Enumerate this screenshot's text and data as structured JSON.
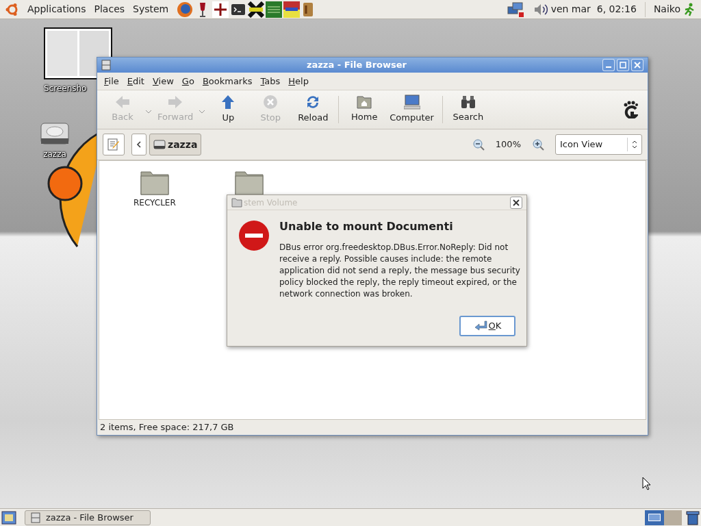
{
  "top_panel": {
    "menus": [
      "Applications",
      "Places",
      "System"
    ],
    "clock": "ven mar  6, 02:16",
    "user": "Naiko"
  },
  "desktop_icons": [
    {
      "label": "Screensho",
      "kind": "thumbnail"
    },
    {
      "label": "zazza",
      "kind": "drive"
    }
  ],
  "window": {
    "title": "zazza - File Browser",
    "menu": [
      "File",
      "Edit",
      "View",
      "Go",
      "Bookmarks",
      "Tabs",
      "Help"
    ],
    "toolbar": [
      {
        "label": "Back",
        "kind": "back",
        "disabled": true,
        "dropdown": true
      },
      {
        "label": "Forward",
        "kind": "forward",
        "disabled": true,
        "dropdown": true
      },
      {
        "label": "Up",
        "kind": "up",
        "disabled": false,
        "dropdown": false
      },
      {
        "label": "Stop",
        "kind": "stop",
        "disabled": true,
        "dropdown": false
      },
      {
        "label": "Reload",
        "kind": "reload",
        "disabled": false,
        "dropdown": false
      },
      {
        "label": "Home",
        "kind": "home",
        "disabled": false,
        "dropdown": false
      },
      {
        "label": "Computer",
        "kind": "computer",
        "disabled": false,
        "dropdown": false
      },
      {
        "label": "Search",
        "kind": "search",
        "disabled": false,
        "dropdown": false
      }
    ],
    "path": "zazza",
    "zoom": "100%",
    "view": "Icon View",
    "folders": [
      {
        "label": "RECYCLER"
      },
      {
        "label": "stem Volume"
      }
    ],
    "status": "2 items, Free space: 217,7 GB"
  },
  "dialog": {
    "heading": "Unable to mount Documenti",
    "message": "DBus error org.freedesktop.DBus.Error.NoReply: Did not receive a reply. Possible causes include: the remote application did not send a reply, the message bus security policy blocked the reply, the reply timeout expired, or the network connection was broken.",
    "button": "OK"
  },
  "taskbar": {
    "tasks": [
      "zazza - File Browser"
    ]
  }
}
